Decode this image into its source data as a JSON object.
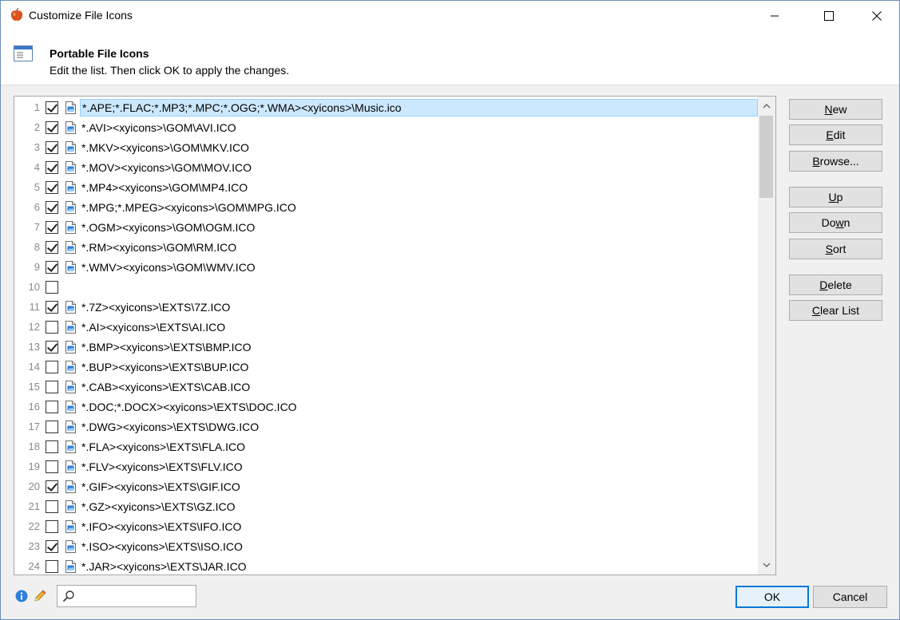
{
  "window": {
    "title": "Customize File Icons",
    "icon": "apple-icon"
  },
  "header": {
    "title": "Portable File Icons",
    "subtitle": "Edit the list. Then click OK to apply the changes."
  },
  "list": {
    "rows": [
      {
        "num": "1",
        "checked": true,
        "has_icon": true,
        "text": "*.APE;*.FLAC;*.MP3;*.MPC;*.OGG;*.WMA><xyicons>\\Music.ico",
        "selected": true
      },
      {
        "num": "2",
        "checked": true,
        "has_icon": true,
        "text": "*.AVI><xyicons>\\GOM\\AVI.ICO"
      },
      {
        "num": "3",
        "checked": true,
        "has_icon": true,
        "text": "*.MKV><xyicons>\\GOM\\MKV.ICO"
      },
      {
        "num": "4",
        "checked": true,
        "has_icon": true,
        "text": "*.MOV><xyicons>\\GOM\\MOV.ICO"
      },
      {
        "num": "5",
        "checked": true,
        "has_icon": true,
        "text": "*.MP4><xyicons>\\GOM\\MP4.ICO"
      },
      {
        "num": "6",
        "checked": true,
        "has_icon": true,
        "text": "*.MPG;*.MPEG><xyicons>\\GOM\\MPG.ICO"
      },
      {
        "num": "7",
        "checked": true,
        "has_icon": true,
        "text": "*.OGM><xyicons>\\GOM\\OGM.ICO"
      },
      {
        "num": "8",
        "checked": true,
        "has_icon": true,
        "text": "*.RM><xyicons>\\GOM\\RM.ICO"
      },
      {
        "num": "9",
        "checked": true,
        "has_icon": true,
        "text": "*.WMV><xyicons>\\GOM\\WMV.ICO"
      },
      {
        "num": "10",
        "checked": false,
        "has_icon": false,
        "text": ""
      },
      {
        "num": "11",
        "checked": true,
        "has_icon": true,
        "text": "*.7Z><xyicons>\\EXTS\\7Z.ICO"
      },
      {
        "num": "12",
        "checked": false,
        "has_icon": true,
        "text": "*.AI><xyicons>\\EXTS\\AI.ICO"
      },
      {
        "num": "13",
        "checked": true,
        "has_icon": true,
        "text": "*.BMP><xyicons>\\EXTS\\BMP.ICO"
      },
      {
        "num": "14",
        "checked": false,
        "has_icon": true,
        "text": "*.BUP><xyicons>\\EXTS\\BUP.ICO"
      },
      {
        "num": "15",
        "checked": false,
        "has_icon": true,
        "text": "*.CAB><xyicons>\\EXTS\\CAB.ICO"
      },
      {
        "num": "16",
        "checked": false,
        "has_icon": true,
        "text": "*.DOC;*.DOCX><xyicons>\\EXTS\\DOC.ICO"
      },
      {
        "num": "17",
        "checked": false,
        "has_icon": true,
        "text": "*.DWG><xyicons>\\EXTS\\DWG.ICO"
      },
      {
        "num": "18",
        "checked": false,
        "has_icon": true,
        "text": "*.FLA><xyicons>\\EXTS\\FLA.ICO"
      },
      {
        "num": "19",
        "checked": false,
        "has_icon": true,
        "text": "*.FLV><xyicons>\\EXTS\\FLV.ICO"
      },
      {
        "num": "20",
        "checked": true,
        "has_icon": true,
        "text": "*.GIF><xyicons>\\EXTS\\GIF.ICO"
      },
      {
        "num": "21",
        "checked": false,
        "has_icon": true,
        "text": "*.GZ><xyicons>\\EXTS\\GZ.ICO"
      },
      {
        "num": "22",
        "checked": false,
        "has_icon": true,
        "text": "*.IFO><xyicons>\\EXTS\\IFO.ICO"
      },
      {
        "num": "23",
        "checked": true,
        "has_icon": true,
        "text": "*.ISO><xyicons>\\EXTS\\ISO.ICO"
      },
      {
        "num": "24",
        "checked": false,
        "has_icon": true,
        "text": "*.JAR><xyicons>\\EXTS\\JAR.ICO"
      }
    ]
  },
  "buttons": {
    "new": {
      "pre": "",
      "u": "N",
      "post": "ew"
    },
    "edit": {
      "pre": "",
      "u": "E",
      "post": "dit"
    },
    "browse": {
      "pre": "",
      "u": "B",
      "post": "rowse..."
    },
    "up": {
      "pre": "",
      "u": "U",
      "post": "p"
    },
    "down": {
      "pre": "Do",
      "u": "w",
      "post": "n"
    },
    "sort": {
      "pre": "",
      "u": "S",
      "post": "ort"
    },
    "delete": {
      "pre": "",
      "u": "D",
      "post": "elete"
    },
    "clear_list": {
      "pre": "",
      "u": "C",
      "post": "lear List"
    }
  },
  "footer": {
    "search_value": "",
    "ok_label": "OK",
    "cancel_label": "Cancel"
  },
  "colors": {
    "selection_bg": "#cce8ff",
    "selection_border": "#99d1ff",
    "default_button_border": "#0078d7"
  }
}
